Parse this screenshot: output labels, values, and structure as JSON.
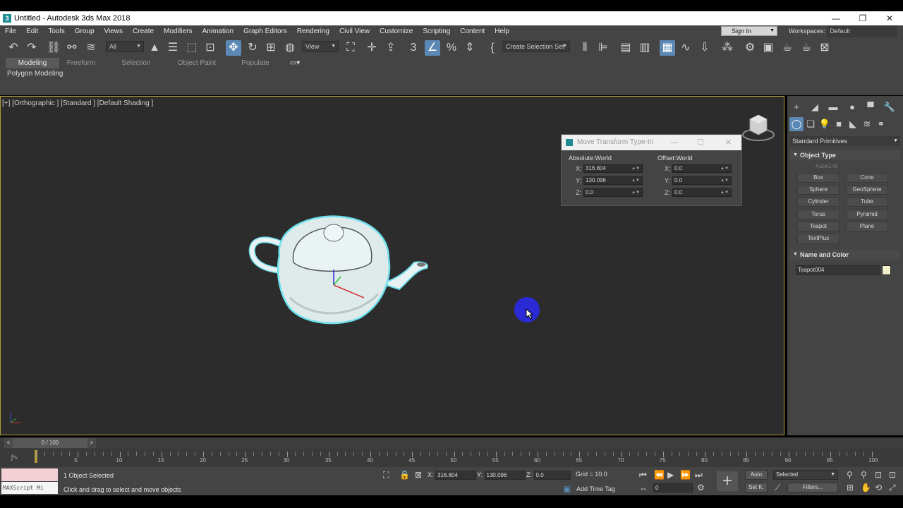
{
  "window": {
    "title": "Untitled - Autodesk 3ds Max 2018",
    "app_icon": "3",
    "controls": [
      "—",
      "❐",
      "✕"
    ]
  },
  "menu": {
    "items": [
      "File",
      "Edit",
      "Tools",
      "Group",
      "Views",
      "Create",
      "Modifiers",
      "Animation",
      "Graph Editors",
      "Rendering",
      "Civil View",
      "Customize",
      "Scripting",
      "Content",
      "Help"
    ],
    "sign_in": "Sign In",
    "workspaces_label": "Workspaces:",
    "workspaces_value": "Default"
  },
  "toolbar": {
    "filter_value": "All",
    "view_value": "View",
    "selection_set": "Create Selection Set"
  },
  "ribbon": {
    "tabs": [
      "Modeling",
      "Freeform",
      "Selection",
      "Object Paint",
      "Populate"
    ],
    "active_tab": "Modeling",
    "panel_label": "Polygon Modeling"
  },
  "viewport": {
    "label": "[+] [Orthographic ] [Standard ] [Default Shading ]",
    "object_color": "#e8f2f2",
    "selection_outline": "#6fe0ee"
  },
  "move_dialog": {
    "title": "Move Transform Type-In",
    "absolute_header": "Absolute:World",
    "offset_header": "Offset:World",
    "absolute": {
      "x": "316.804",
      "y": "130.096",
      "z": "0.0"
    },
    "offset": {
      "x": "0.0",
      "y": "0.0",
      "z": "0.0"
    },
    "labels": {
      "x": "X:",
      "y": "Y:",
      "z": "Z:"
    }
  },
  "command_panel": {
    "category": "Standard Primitives",
    "object_type_header": "Object Type",
    "autogrid": "AutoGrid",
    "primitives": [
      "Box",
      "Cone",
      "Sphere",
      "GeoSphere",
      "Cylinder",
      "Tube",
      "Torus",
      "Pyramid",
      "Teapot",
      "Plane",
      "TextPlus"
    ],
    "name_color_header": "Name and Color",
    "object_name": "Teapot004",
    "object_color": "#f2f0c8"
  },
  "timeline": {
    "frame_display": "0 / 100",
    "arrow_left": "<",
    "arrow_right": ">",
    "ticks": [
      "0",
      "5",
      "10",
      "15",
      "20",
      "25",
      "30",
      "35",
      "40",
      "45",
      "50",
      "55",
      "60",
      "65",
      "70",
      "75",
      "80",
      "85",
      "90",
      "95",
      "100"
    ]
  },
  "status": {
    "maxscript": "MAXScript Mi",
    "selection_count": "1 Object Selected",
    "prompt": "Click and drag to select and move objects",
    "x_label": "X:",
    "x_value": "316.804",
    "y_label": "Y:",
    "y_value": "130.096",
    "z_label": "Z:",
    "z_value": "0.0",
    "grid": "Grid = 10.0",
    "add_time_tag": "Add Time Tag",
    "auto_key": "Auto",
    "set_key": "Set K.",
    "selected_dd": "Selected",
    "filters": "Filters...",
    "current_frame": "0"
  }
}
